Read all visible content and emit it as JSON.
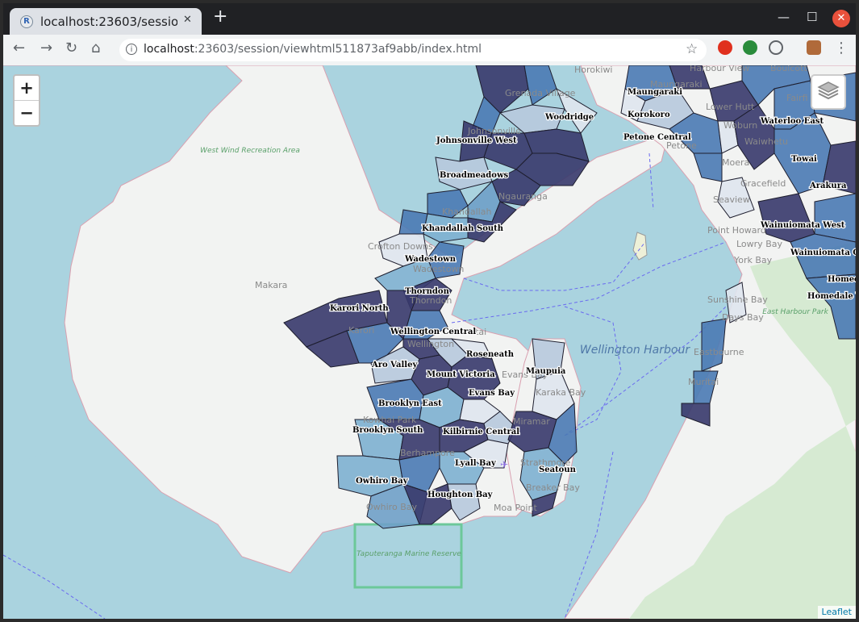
{
  "browser": {
    "tab_title": "localhost:23603/session/v",
    "tab_close": "✕",
    "new_tab": "+",
    "url_host": "localhost",
    "url_rest": ":23603/session/viewhtml511873af9abb/index.html",
    "menu": "⋮"
  },
  "map": {
    "zoom_in": "+",
    "zoom_out": "−",
    "attribution": "Leaflet",
    "colors": {
      "sea": "#aad3df",
      "land": "#f2f3f2",
      "park": "#cfe7cf",
      "dark": "#37386b",
      "mid": "#4a7ab4",
      "light": "#b7c9dd",
      "lightest": "#dfe6ee"
    },
    "suburbs": [
      "Woodridge",
      "Johnsonville West",
      "Broadmeadows",
      "Khandallah South",
      "Wadestown",
      "Thorndon",
      "Karori North",
      "Wellington Central",
      "Roseneath",
      "Aro Valley",
      "Mount Victoria",
      "Evans Bay",
      "Maupuia",
      "Brooklyn East",
      "Brooklyn South",
      "Kilbirnie Central",
      "Lyall Bay",
      "Seatoun",
      "Owhiro Bay",
      "Houghton Bay",
      "Maungaraki",
      "Korokoro",
      "Petone Central",
      "Waterloo East",
      "Towai",
      "Arakura",
      "Wainuiomata West",
      "Wainuiomata Central",
      "Homed",
      "Homedale W"
    ],
    "places": [
      "Makara",
      "Crofton Downs",
      "Ngauranga",
      "Karori",
      "Wellington",
      "Berhampore",
      "Owhiro Bay",
      "Miramar",
      "Strathmore",
      "Breaker Bay",
      "Moa Point",
      "Karaka Bay",
      "Evans Bay",
      "Grenada Village",
      "Johnsonville",
      "Khandallah",
      "Wadestown",
      "Thorndon",
      "Kowhai Park",
      "Lower Hutt",
      "Woburn",
      "Waiwhetu",
      "Fairfi",
      "Point Howard",
      "Lowry Bay",
      "York Bay",
      "Sunshine Bay",
      "Days Bay",
      "Eastbourne",
      "Muritai",
      "Gracefield",
      "Seaview",
      "Maungaraki",
      "Horokiwi",
      "Petone",
      "Harbour View",
      "Boulcott",
      "Moera",
      "Hataitai"
    ],
    "parks": [
      "West Wind Recreation Area",
      "Taputeranga Marine Reserve",
      "East Harbour Park"
    ],
    "water": [
      "Wellington Harbour"
    ]
  }
}
